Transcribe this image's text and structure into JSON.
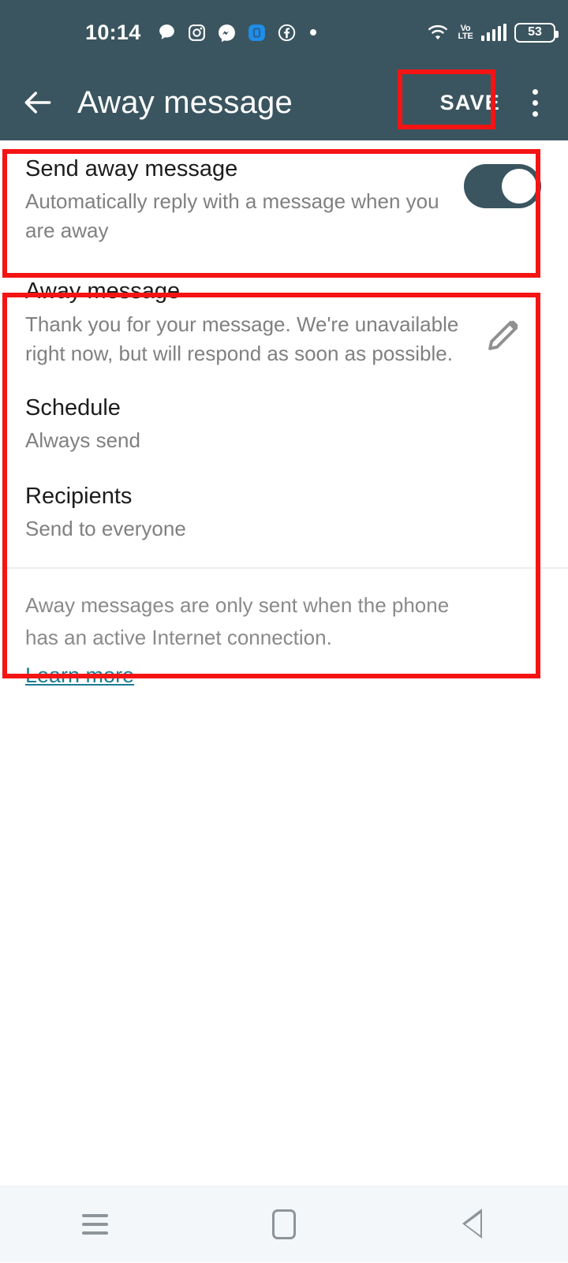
{
  "status_bar": {
    "time": "10:14",
    "icons": [
      "speech-bubble-icon",
      "instagram-icon",
      "messenger-icon",
      "blue-app-icon",
      "facebook-icon",
      "dot-icon"
    ],
    "network_label": "VoLTE",
    "volte_line1": "Vo",
    "volte_line2": "LTE",
    "battery_percent": "53",
    "signal_bars": 5,
    "wifi": "wifi-icon"
  },
  "app_bar": {
    "back_icon": "back-arrow-icon",
    "title": "Away message",
    "save_label": "SAVE",
    "overflow_icon": "overflow-menu-icon"
  },
  "toggle_section": {
    "title": "Send away message",
    "subtitle": "Automatically reply with a message when you are away",
    "enabled": true,
    "toggle_color": "#3a555f",
    "knob_color": "#ffffff"
  },
  "message_section": {
    "away_message": {
      "title": "Away message",
      "value": "Thank you for your message. We're unavailable right now, but will respond as soon as possible.",
      "edit_icon": "pencil-icon"
    },
    "schedule": {
      "title": "Schedule",
      "value": "Always send"
    },
    "recipients": {
      "title": "Recipients",
      "value": "Send to everyone"
    }
  },
  "footer": {
    "note": "Away messages are only sent when the phone has an active Internet connection.",
    "link_label": "Learn more",
    "link_color": "#1b7c92"
  },
  "navigation_bar": {
    "recents_label": "recents-icon",
    "home_label": "home-icon",
    "back_label": "back-icon"
  },
  "annotations": {
    "color": "#f41414",
    "boxes": [
      "save-button",
      "send-away-message-toggle",
      "away-message-settings"
    ]
  },
  "theme": {
    "header_bg": "#3a555f",
    "page_bg": "#ffffff",
    "title_text": "#1c1c1c",
    "sub_text": "#808080",
    "nav_bg": "#f4f7f9"
  }
}
